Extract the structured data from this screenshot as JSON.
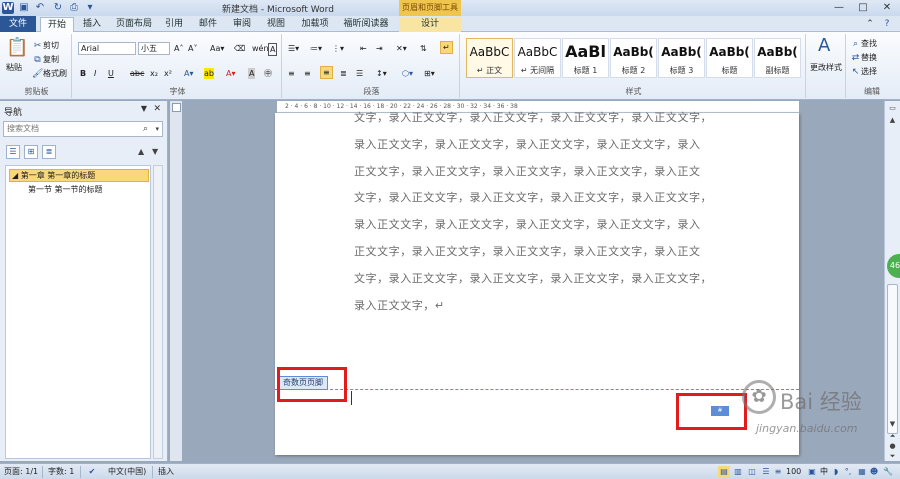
{
  "titlebar": {
    "title": "新建文档 - Microsoft Word",
    "context_tab_title": "页眉和页脚工具",
    "qat": [
      "word-logo",
      "save-icon",
      "undo-icon",
      "redo-icon",
      "print-preview-icon"
    ],
    "window_buttons": [
      "—",
      "□",
      "✕"
    ]
  },
  "tabs": [
    "文件",
    "开始",
    "插入",
    "页面布局",
    "引用",
    "邮件",
    "审阅",
    "视图",
    "加载项",
    "福昕阅读器",
    "设计"
  ],
  "ribbon": {
    "clipboard": {
      "paste": "粘贴",
      "cut": "剪切",
      "copy": "复制",
      "format_painter": "格式刷",
      "label": "剪贴板"
    },
    "font": {
      "name": "Arial",
      "size": "小五",
      "label": "字体"
    },
    "paragraph": {
      "label": "段落"
    },
    "styles": {
      "items": [
        {
          "sample": "AaBbC",
          "name": "↵ 正文"
        },
        {
          "sample": "AaBbC",
          "name": "↵ 无间隔"
        },
        {
          "sample": "AaBl",
          "name": "标题 1"
        },
        {
          "sample": "AaBb(",
          "name": "标题 2"
        },
        {
          "sample": "AaBb(",
          "name": "标题 3"
        },
        {
          "sample": "AaBb(",
          "name": "标题"
        },
        {
          "sample": "AaBb(",
          "name": "副标题"
        }
      ],
      "change": "更改样式",
      "label": "样式"
    },
    "editing": {
      "find": "查找",
      "replace": "替换",
      "select": "选择",
      "label": "编辑"
    }
  },
  "nav": {
    "title": "导航",
    "search_placeholder": "搜索文档",
    "headings": [
      "第一章 第一章的标题",
      "第一节 第一节的标题"
    ]
  },
  "document": {
    "lines": [
      "文字，录入正文文字，录入正文文字，录入正文文字，录入正文文字，",
      "录入正文文字，录入正文文字，录入正文文字，录入正文文字，录入",
      "正文文字，录入正文文字，录入正文文字，录入正文文字，录入正文",
      "文字，录入正文文字，录入正文文字，录入正文文字，录入正文文字，",
      "录入正文文字，录入正文文字，录入正文文字，录入正文文字，录入",
      "正文文字，录入正文文字，录入正文文字，录入正文文字，录入正文",
      "文字，录入正文文字，录入正文文字，录入正文文字，录入正文文字，",
      "录入正文文字，↵"
    ],
    "footer_tag": "奇数页页脚",
    "ruler_marks": "2 · 4 · 6 · 8 · 10 · 12 · 14 · 16 · 18 · 20 · 22 · 24 · 26 · 28 · 30 · 32 · 34 · 36 · 38"
  },
  "watermark": {
    "text": "Bai 经验",
    "url": "jingyan.baidu.com"
  },
  "badge": "46",
  "statusbar": {
    "page": "页面: 1/1",
    "words": "字数: 1",
    "language": "中文(中国)",
    "mode": "插入",
    "zoom": "100"
  }
}
